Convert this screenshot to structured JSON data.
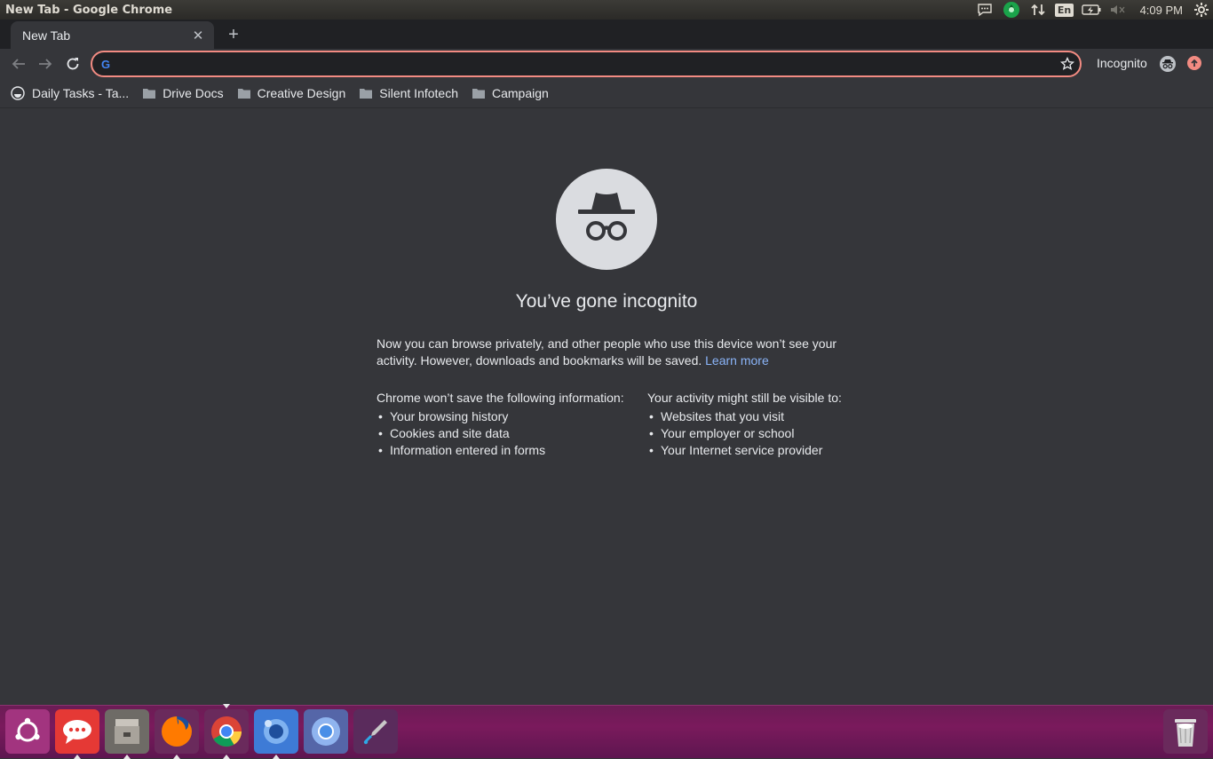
{
  "os_panel": {
    "window_title": "New Tab - Google Chrome",
    "keyboard_layout": "En",
    "clock": "4:09 PM",
    "tray_icons": [
      "messaging-icon",
      "sync-icon",
      "network-icon",
      "keyboard-icon",
      "battery-icon",
      "volume-muted-icon",
      "settings-gear-icon"
    ]
  },
  "tabs": [
    {
      "title": "New Tab",
      "active": true
    }
  ],
  "toolbar": {
    "omnibox_value": "",
    "omnibox_icon": "G",
    "incognito_label": "Incognito"
  },
  "bookmarks": [
    {
      "label": "Daily Tasks - Ta...",
      "icon": "site-favicon"
    },
    {
      "label": "Drive Docs",
      "icon": "folder-icon"
    },
    {
      "label": "Creative Design",
      "icon": "folder-icon"
    },
    {
      "label": "Silent Infotech",
      "icon": "folder-icon"
    },
    {
      "label": "Campaign",
      "icon": "folder-icon"
    }
  ],
  "incognito_page": {
    "headline": "You’ve gone incognito",
    "intro": "Now you can browse privately, and other people who use this device won’t see your activity. However, downloads and bookmarks will be saved.",
    "learn_more": "Learn more",
    "not_saved_title": "Chrome won’t save the following information:",
    "not_saved_items": [
      "Your browsing history",
      "Cookies and site data",
      "Information entered in forms"
    ],
    "visible_title": "Your activity might still be visible to:",
    "visible_items": [
      "Websites that you visit",
      "Your employer or school",
      "Your Internet service provider"
    ]
  },
  "launcher": [
    {
      "name": "ubuntu-dash",
      "color": "#a2347f"
    },
    {
      "name": "messaging-app",
      "color": "#e53935"
    },
    {
      "name": "file-archive",
      "color": "#8d8a85"
    },
    {
      "name": "firefox",
      "color": "#e66000"
    },
    {
      "name": "google-chrome",
      "color": "#4caf50"
    },
    {
      "name": "photos-app",
      "color": "#3e7bd6"
    },
    {
      "name": "chromium",
      "color": "#4a8fe7"
    },
    {
      "name": "color-picker",
      "color": "#5a2b5c"
    },
    {
      "name": "trash",
      "color": "#cfcfcf"
    }
  ],
  "colors": {
    "chrome_dark": "#35363a",
    "tab_strip": "#202124",
    "link": "#8ab4f8",
    "omnibox_focus": "#f28b82",
    "launcher": "#7a1a5c"
  }
}
